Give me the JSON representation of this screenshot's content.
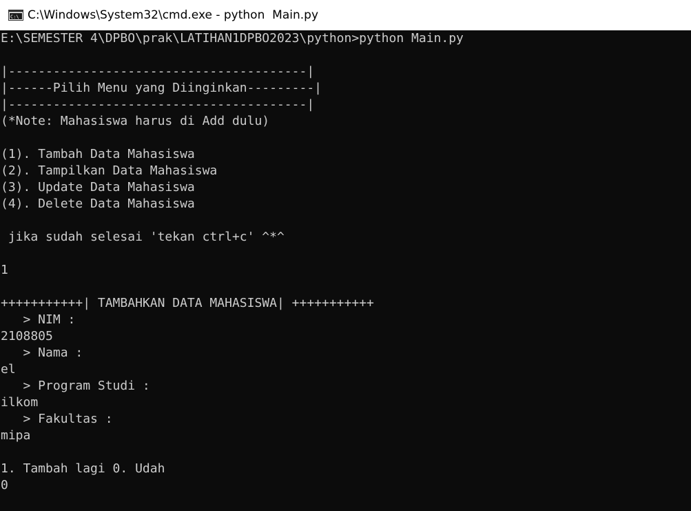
{
  "window": {
    "title": "C:\\Windows\\System32\\cmd.exe - python  Main.py",
    "icon": "cmd-console-icon"
  },
  "console": {
    "lines": [
      "E:\\SEMESTER 4\\DPBO\\prak\\LATIHAN1DPBO2023\\python>python Main.py",
      "",
      "|----------------------------------------|",
      "|------Pilih Menu yang Diinginkan---------|",
      "|----------------------------------------|",
      "(*Note: Mahasiswa harus di Add dulu)",
      "",
      "(1). Tambah Data Mahasiswa",
      "(2). Tampilkan Data Mahasiswa",
      "(3). Update Data Mahasiswa",
      "(4). Delete Data Mahasiswa",
      "",
      " jika sudah selesai 'tekan ctrl+c' ^*^",
      "",
      "1",
      "",
      "+++++++++++| TAMBAHKAN DATA MAHASISWA| +++++++++++",
      "   > NIM :",
      "2108805",
      "   > Nama :",
      "el",
      "   > Program Studi :",
      "ilkom",
      "   > Fakultas :",
      "mipa",
      "",
      "1. Tambah lagi 0. Udah",
      "0"
    ]
  },
  "colors": {
    "background": "#0c0c0c",
    "text": "#cccccc",
    "titlebar": "#ffffff"
  }
}
